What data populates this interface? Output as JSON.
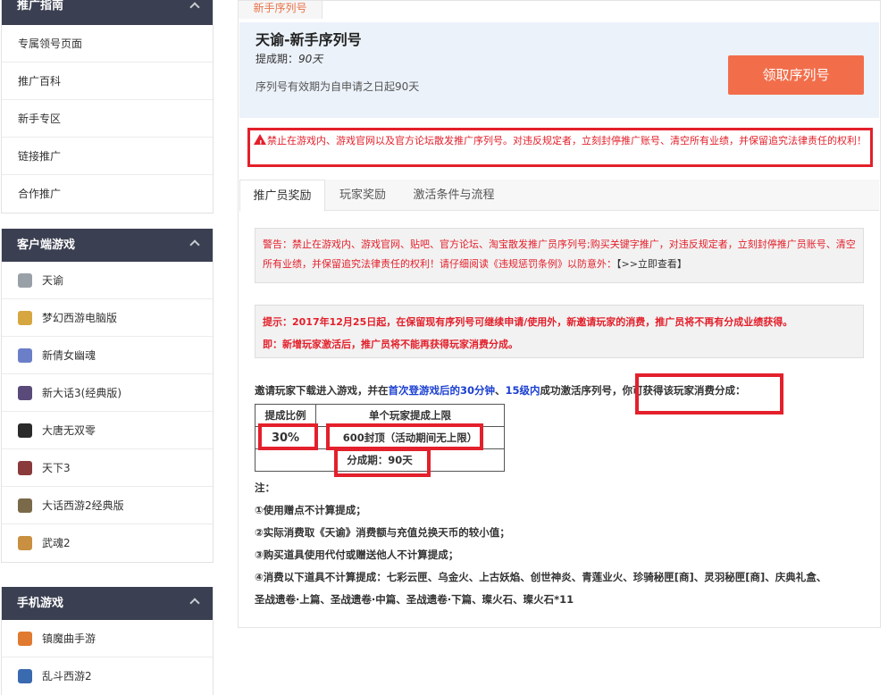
{
  "sidebar": {
    "promo_guide": {
      "title": "推广指南",
      "items": [
        "专属领号页面",
        "推广百科",
        "新手专区",
        "链接推广",
        "合作推广"
      ]
    },
    "client_games": {
      "title": "客户端游戏",
      "items": [
        {
          "label": "天谕",
          "color": "#9aa0a8"
        },
        {
          "label": "梦幻西游电脑版",
          "color": "#d6a640"
        },
        {
          "label": "新倩女幽魂",
          "color": "#6b7fc8"
        },
        {
          "label": "新大话3(经典版)",
          "color": "#5a4a7a"
        },
        {
          "label": "大唐无双零",
          "color": "#2a2a2a"
        },
        {
          "label": "天下3",
          "color": "#8a3a3a"
        },
        {
          "label": "大话西游2经典版",
          "color": "#7a6a4a"
        },
        {
          "label": "武魂2",
          "color": "#c89040"
        }
      ]
    },
    "mobile_games": {
      "title": "手机游戏",
      "items": [
        {
          "label": "镇魔曲手游",
          "color": "#e07a30"
        },
        {
          "label": "乱斗西游2",
          "color": "#3a6ab0"
        }
      ]
    }
  },
  "main": {
    "top_tab": "新手序列号",
    "hero": {
      "title": "天谕-新手序列号",
      "period_label": "提成期：",
      "period_value": "90天",
      "validity": "序列号有效期为自申请之日起90天",
      "claim_button": "领取序列号"
    },
    "ban_notice": "禁止在游戏内、游戏官网以及官方论坛散发推广序列号。对违反规定者，立刻封停推广账号、清空所有业绩，并保留追究法律责任的权利！",
    "tabs": [
      "推广员奖励",
      "玩家奖励",
      "激活条件与流程"
    ],
    "warning_text": "警告：禁止在游戏内、游戏官网、贴吧、官方论坛、淘宝散发推广员序列号;购买关键字推广，对违反规定者，立刻封停推广员账号、清空所有业绩，并保留追究法律责任的权利！请仔细阅读《违规惩罚条例》以防意外：",
    "warning_link": "【>>立即查看】",
    "tip_line1": "提示：2017年12月25日起，在保留现有序列号可继续申请/使用外，新邀请玩家的消费，推广员将不再有分成业绩获得。",
    "tip_line2": "即：新增玩家激活后，推广员将不能再获得玩家消费分成。",
    "invite": {
      "prefix": "邀请玩家下载进入游戏，并在",
      "blue1": "首次登游戏后的30分钟",
      "sep": "、",
      "blue2": "15级内",
      "mid": "成功激活序列号，",
      "highlight": "你可获得该玩家消费分成："
    },
    "table": {
      "header_rate": "提成比例",
      "header_cap": "单个玩家提成上限",
      "rate": "30%",
      "cap": "600封顶（活动期间无上限）",
      "period": "分成期：90天"
    },
    "notes": {
      "title": "注：",
      "items": [
        "①使用赠点不计算提成；",
        "②实际消费取《天谕》消费额与充值兑换天币的较小值；",
        "③购买道具使用代付或赠送他人不计算提成；",
        "④消费以下道具不计算提成：七彩云匣、乌金火、上古妖焰、创世神炎、青莲业火、珍骑秘匣[商]、灵羽秘匣[商]、庆典礼盒、",
        "圣战遗卷·上篇、圣战遗卷·中篇、圣战遗卷·下篇、璨火石、璨火石*11"
      ]
    }
  }
}
